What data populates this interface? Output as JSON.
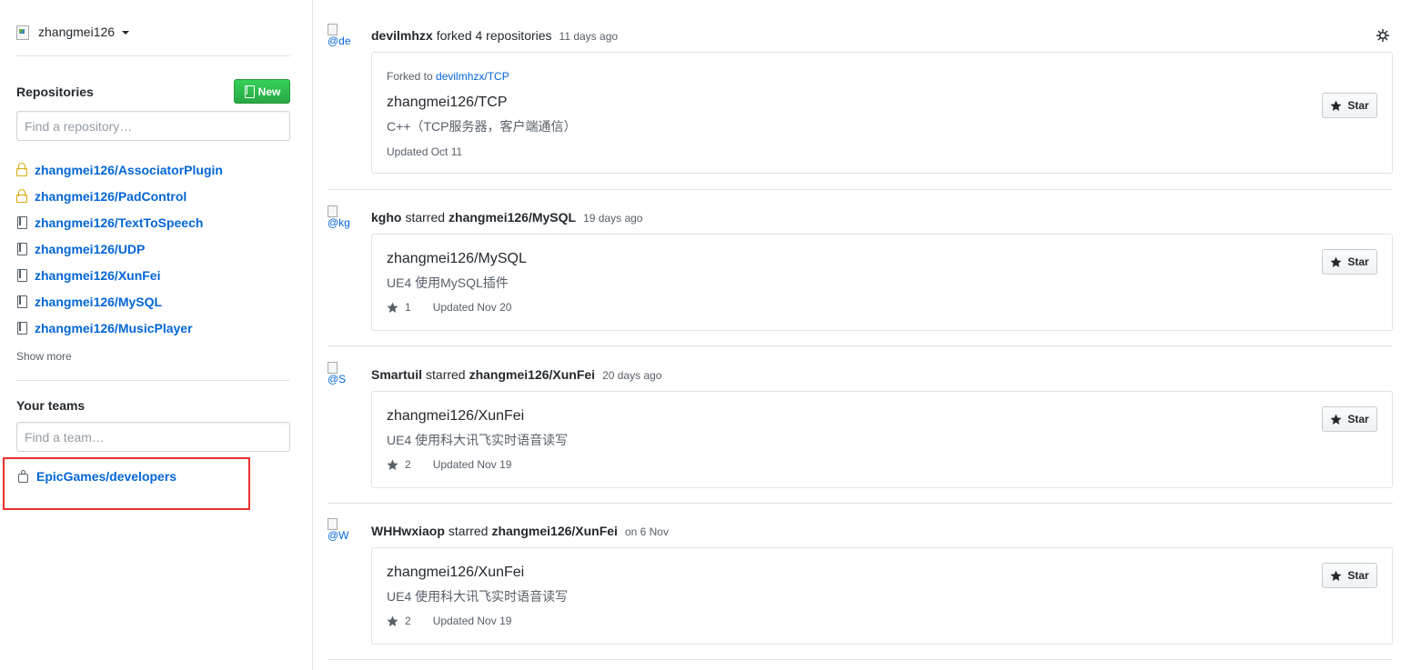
{
  "sidebar": {
    "account": {
      "name": "zhangmei126"
    },
    "repositories": {
      "heading": "Repositories",
      "new_label": "New",
      "filter_placeholder": "Find a repository…",
      "items": [
        {
          "name": "zhangmei126/AssociatorPlugin",
          "icon": "lock-icon"
        },
        {
          "name": "zhangmei126/PadControl",
          "icon": "lock-icon"
        },
        {
          "name": "zhangmei126/TextToSpeech",
          "icon": "repo-icon"
        },
        {
          "name": "zhangmei126/UDP",
          "icon": "repo-icon"
        },
        {
          "name": "zhangmei126/XunFei",
          "icon": "repo-icon"
        },
        {
          "name": "zhangmei126/MySQL",
          "icon": "repo-icon"
        },
        {
          "name": "zhangmei126/MusicPlayer",
          "icon": "repo-icon"
        }
      ],
      "show_more": "Show more"
    },
    "teams": {
      "heading": "Your teams",
      "filter_placeholder": "Find a team…",
      "items": [
        {
          "name": "EpicGames/developers",
          "icon": "team-icon"
        }
      ]
    },
    "highlight_color": "#e8312e"
  },
  "feed": {
    "events": [
      {
        "avatar_alt": "@de",
        "actor": "devilmhzx",
        "action": "forked 4 repositories",
        "target": "",
        "time": "11 days ago",
        "card": {
          "forked_prefix": "Forked to ",
          "forked_link": "devilmhzx/TCP",
          "repo": "zhangmei126/TCP",
          "description": "C++（TCP服务器，客户端通信）",
          "stars": "",
          "updated": "Updated Oct 11",
          "star_label": "Star"
        }
      },
      {
        "avatar_alt": "@kg",
        "actor": "kgho",
        "action": "starred",
        "target": "zhangmei126/MySQL",
        "time": "19 days ago",
        "card": {
          "repo": "zhangmei126/MySQL",
          "description": "UE4 使用MySQL插件",
          "stars": "1",
          "updated": "Updated Nov 20",
          "star_label": "Star"
        }
      },
      {
        "avatar_alt": "@S",
        "actor": "Smartuil",
        "action": "starred",
        "target": "zhangmei126/XunFei",
        "time": "20 days ago",
        "card": {
          "repo": "zhangmei126/XunFei",
          "description": "UE4 使用科大讯飞实时语音读写",
          "stars": "2",
          "updated": "Updated Nov 19",
          "star_label": "Star"
        }
      },
      {
        "avatar_alt": "@W",
        "actor": "WHHwxiaop",
        "action": "starred",
        "target": "zhangmei126/XunFei",
        "time": "on 6 Nov",
        "card": {
          "repo": "zhangmei126/XunFei",
          "description": "UE4 使用科大讯飞实时语音读写",
          "stars": "2",
          "updated": "Updated Nov 19",
          "star_label": "Star"
        }
      }
    ]
  }
}
